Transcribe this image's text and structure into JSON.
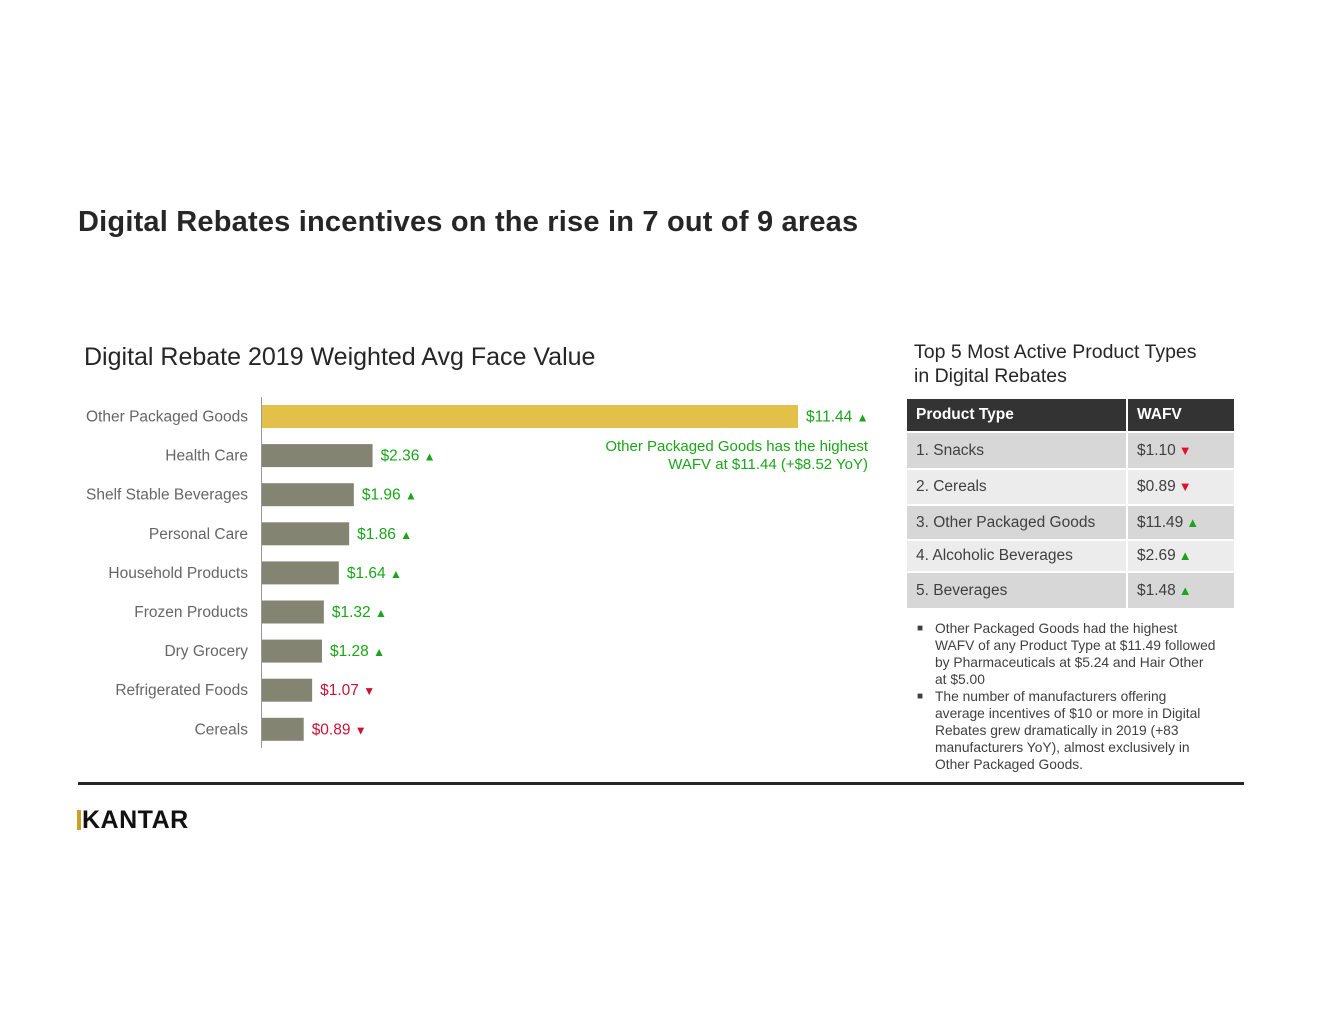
{
  "page": {
    "title": "Digital Rebates incentives on the rise in 7 out of 9 areas",
    "logo": "KANTAR"
  },
  "colors": {
    "highlight_bar": "#e2c04a",
    "bar": "#838472",
    "up": "#1aa51a",
    "down": "#c81432"
  },
  "chart_data": {
    "type": "bar",
    "orientation": "horizontal",
    "title": "Digital Rebate 2019 Weighted Avg Face Value",
    "categories": [
      "Other Packaged Goods",
      "Health Care",
      "Shelf Stable Beverages",
      "Personal Care",
      "Household Products",
      "Frozen Products",
      "Dry Grocery",
      "Refrigerated Foods",
      "Cereals"
    ],
    "values": [
      11.44,
      2.36,
      1.96,
      1.86,
      1.64,
      1.32,
      1.28,
      1.07,
      0.89
    ],
    "value_labels": [
      "$11.44",
      "$2.36",
      "$1.96",
      "$1.86",
      "$1.64",
      "$1.32",
      "$1.28",
      "$1.07",
      "$0.89"
    ],
    "trend": [
      "up",
      "up",
      "up",
      "up",
      "up",
      "up",
      "up",
      "down",
      "down"
    ],
    "highlight_index": 0,
    "xlim": [
      0,
      11.44
    ],
    "grid": false,
    "annotation": "Other Packaged Goods has the highest WAFV at $11.44 (+$8.52 YoY)"
  },
  "table": {
    "title_line1": "Top 5 Most Active Product Types",
    "title_line2": "in Digital Rebates",
    "headers": [
      "Product Type",
      "WAFV"
    ],
    "rows": [
      {
        "name": "1. Snacks",
        "value": "$1.10",
        "trend": "down"
      },
      {
        "name": "2. Cereals",
        "value": "$0.89",
        "trend": "down"
      },
      {
        "name": "3. Other Packaged Goods",
        "value": "$11.49",
        "trend": "up"
      },
      {
        "name": "4. Alcoholic Beverages",
        "value": "$2.69",
        "trend": "up"
      },
      {
        "name": "5. Beverages",
        "value": "$1.48",
        "trend": "up"
      }
    ]
  },
  "notes": [
    "Other Packaged Goods had the highest WAFV of any Product Type at $11.49 followed by Pharmaceuticals at $5.24 and Hair Other at $5.00",
    "The number of manufacturers offering average incentives of $10 or more in Digital Rebates grew dramatically in 2019 (+83 manufacturers YoY), almost exclusively in Other Packaged Goods."
  ]
}
